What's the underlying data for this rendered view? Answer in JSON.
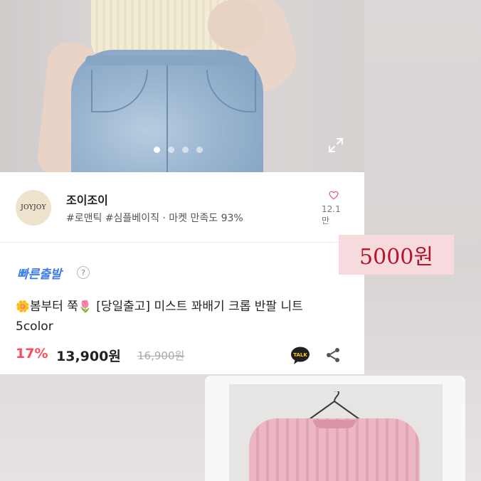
{
  "photo": {
    "carousel_dots": 4,
    "active_dot": 1,
    "expand_icon": "expand-icon"
  },
  "shop": {
    "logo_text": "JOYJOY",
    "name": "조이조이",
    "tags": "#로맨틱 #심플베이직 · 마켓 만족도 93%",
    "like_count": "12.1만",
    "heart_icon": "heart-outline-icon"
  },
  "product": {
    "fast_shipping": "빠른출발",
    "help_icon": "question-icon",
    "title_emoji_1": "🌼",
    "title_part_1": "봄부터 쭉",
    "title_emoji_2": "🌷",
    "title_part_2": " [당일출고] 미스트 꽈배기 크롭 반팔 니트 5color",
    "discount": "17%",
    "price": "13,900원",
    "original_price": "16,900원",
    "talk_icon_text": "TALK",
    "share_icon": "share-icon"
  },
  "overlay": {
    "sticker_price": "5000원"
  },
  "colors": {
    "accent_blue": "#3c7cf0",
    "discount_red": "#ff4a5a",
    "heart_pink": "#e4536c",
    "sticker_bg": "#f7dadd",
    "sticker_text": "#b3152c"
  }
}
